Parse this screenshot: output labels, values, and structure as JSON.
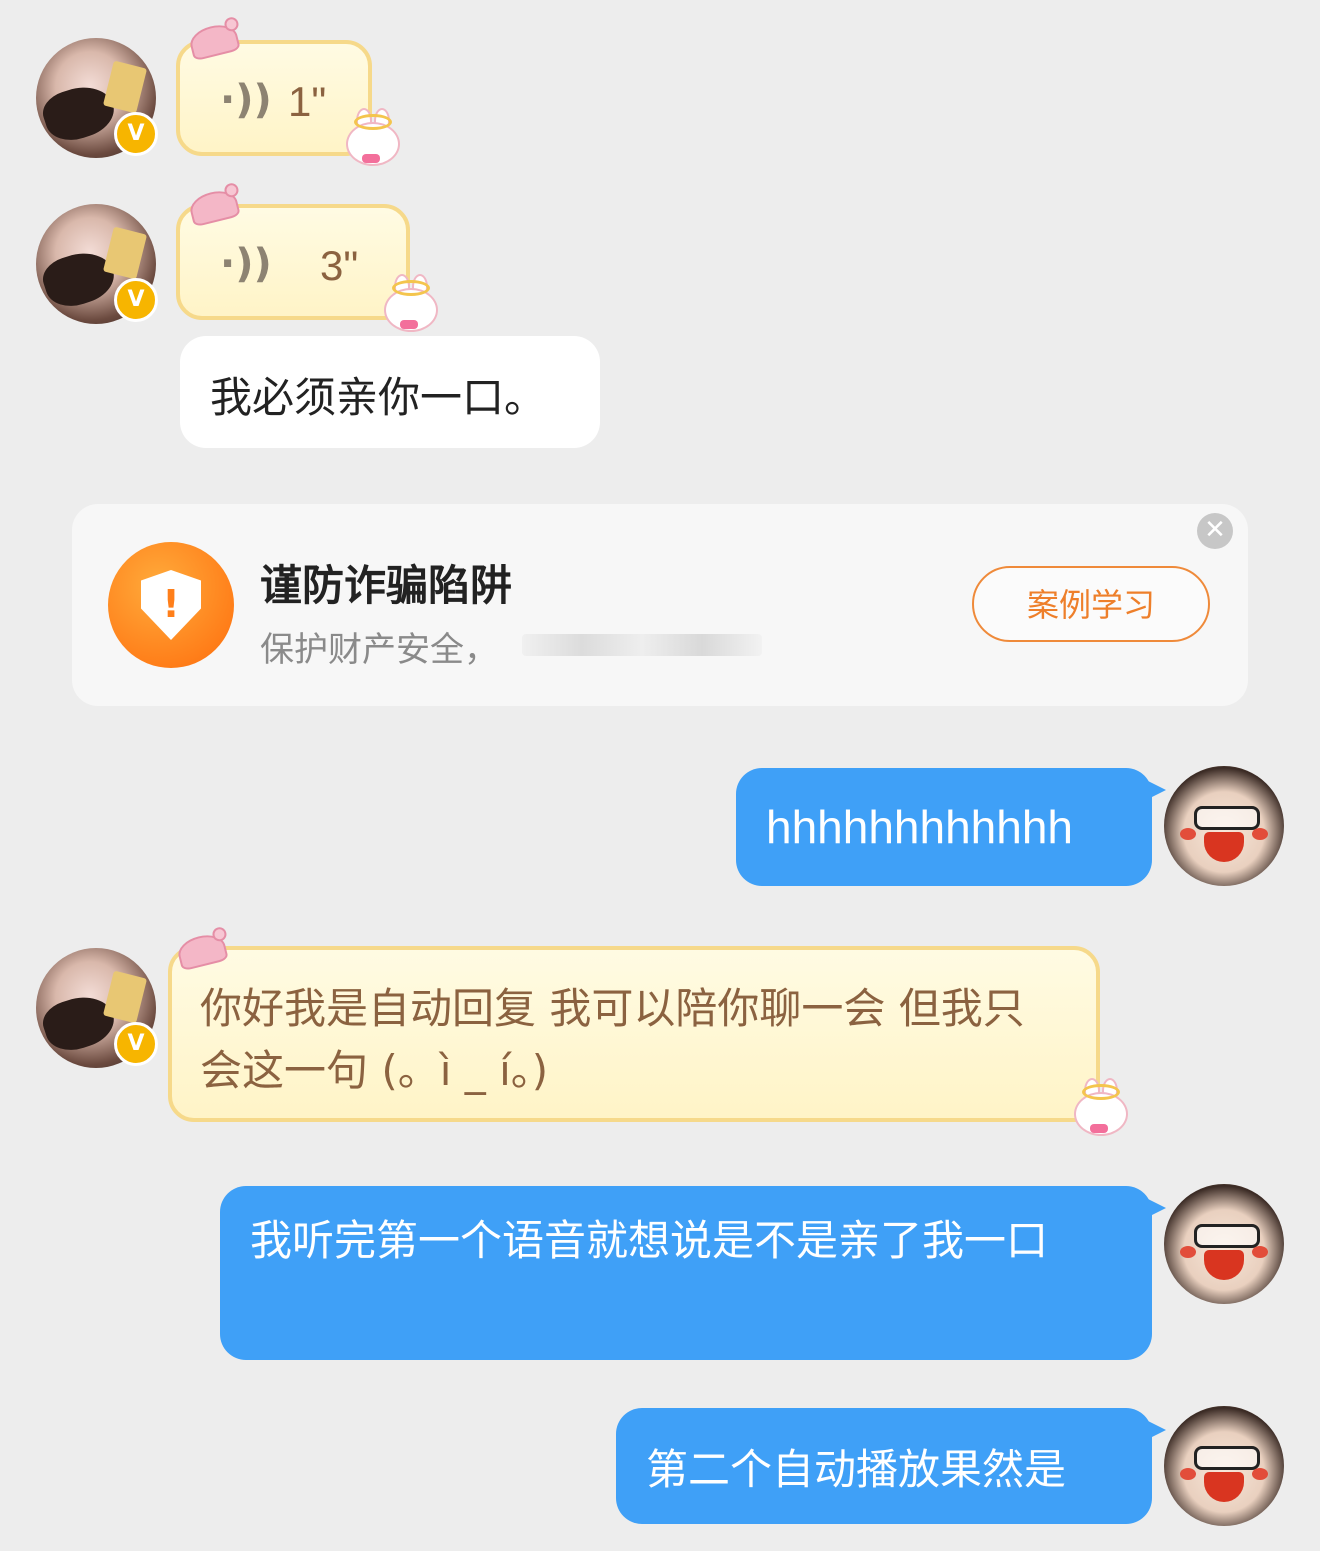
{
  "messages": {
    "voice1": {
      "icon": "voice-wave-icon",
      "duration": "1\""
    },
    "voice2": {
      "icon": "voice-wave-icon",
      "duration": "3\""
    },
    "text_incoming": "我必须亲你一口。",
    "outgoing1": "hhhhhhhhhhhh",
    "auto_reply": "你好我是自动回复 我可以陪你聊一会 但我只会这一句 (。ì _ í。)",
    "outgoing2": "我听完第一个语音就想说是不是亲了我一口",
    "outgoing3": "第二个自动播放果然是"
  },
  "security_card": {
    "title": "谨防诈骗陷阱",
    "subtitle": "保护财产安全，",
    "button": "案例学习",
    "close_symbol": "✕",
    "shield_symbol": "!"
  },
  "badge": {
    "verified": "V"
  },
  "colors": {
    "background": "#ededed",
    "outgoing_bubble": "#3fa0f7",
    "yellow_bubble_border": "#f6d98a",
    "accent_orange": "#ff7f1a",
    "verified_badge": "#f7b500"
  }
}
